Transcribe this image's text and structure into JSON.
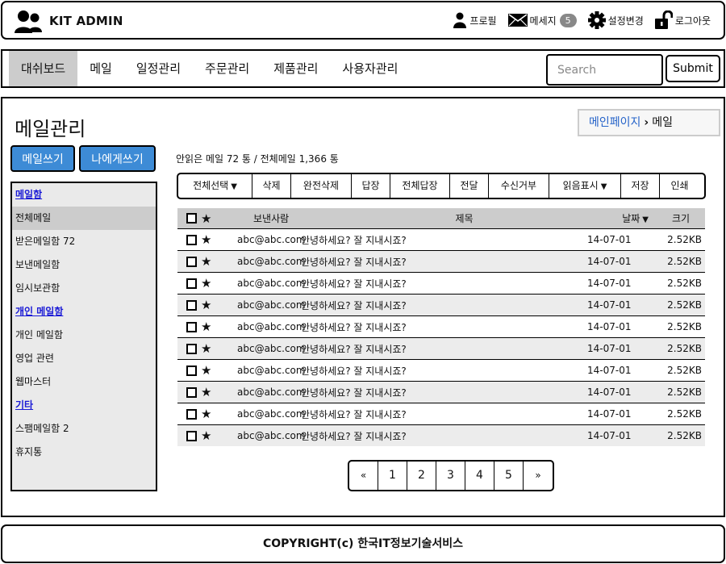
{
  "header": {
    "brand": "KIT ADMIN",
    "profile": "프로필",
    "messages": "메세지",
    "message_count": "5",
    "settings": "설정변경",
    "logout": "로그아웃"
  },
  "nav": {
    "tabs": [
      "대쉬보드",
      "메일",
      "일정관리",
      "주문관리",
      "제품관리",
      "사용자관리"
    ],
    "search_placeholder": "Search",
    "submit": "Submit"
  },
  "page": {
    "title": "메일관리",
    "breadcrumb": [
      "메인페이지",
      "메일"
    ],
    "compose": "메일쓰기",
    "self_compose": "나에게쓰기",
    "summary": "안읽은 메일 72 통 / 전체메일 1,366 통"
  },
  "sidebar": {
    "items": [
      {
        "label": "메일함",
        "type": "head"
      },
      {
        "label": "전체메일",
        "type": "active"
      },
      {
        "label": "받은메일함 72",
        "type": "item"
      },
      {
        "label": "보낸메일함",
        "type": "item"
      },
      {
        "label": "임시보관함",
        "type": "item"
      },
      {
        "label": "개인 메일함",
        "type": "head"
      },
      {
        "label": "개인 메일함",
        "type": "item"
      },
      {
        "label": "영업 관련",
        "type": "item"
      },
      {
        "label": "웹마스터",
        "type": "item"
      },
      {
        "label": "기타",
        "type": "head"
      },
      {
        "label": "스팸메일함 2",
        "type": "item"
      },
      {
        "label": "휴지통",
        "type": "item"
      }
    ]
  },
  "toolbar": {
    "select_all": "전체선택",
    "delete": "삭제",
    "perm_delete": "완전삭제",
    "reply": "답장",
    "reply_all": "전체답장",
    "forward": "전달",
    "block": "수신거부",
    "mark_read": "읽음표시",
    "save": "저장",
    "print": "인쇄"
  },
  "table": {
    "headers": {
      "from": "보낸사람",
      "subject": "제목",
      "date": "날짜",
      "size": "크기"
    },
    "rows": [
      {
        "from": "abc@abc.com",
        "subject": "안녕하세요? 잘 지내시죠?",
        "date": "14-07-01",
        "size": "2.52KB"
      },
      {
        "from": "abc@abc.com",
        "subject": "안녕하세요? 잘 지내시죠?",
        "date": "14-07-01",
        "size": "2.52KB"
      },
      {
        "from": "abc@abc.com",
        "subject": "안녕하세요? 잘 지내시죠?",
        "date": "14-07-01",
        "size": "2.52KB"
      },
      {
        "from": "abc@abc.com",
        "subject": "안녕하세요? 잘 지내시죠?",
        "date": "14-07-01",
        "size": "2.52KB"
      },
      {
        "from": "abc@abc.com",
        "subject": "안녕하세요? 잘 지내시죠?",
        "date": "14-07-01",
        "size": "2.52KB"
      },
      {
        "from": "abc@abc.com",
        "subject": "안녕하세요? 잘 지내시죠?",
        "date": "14-07-01",
        "size": "2.52KB"
      },
      {
        "from": "abc@abc.com",
        "subject": "안녕하세요? 잘 지내시죠?",
        "date": "14-07-01",
        "size": "2.52KB"
      },
      {
        "from": "abc@abc.com",
        "subject": "안녕하세요? 잘 지내시죠?",
        "date": "14-07-01",
        "size": "2.52KB"
      },
      {
        "from": "abc@abc.com",
        "subject": "안녕하세요? 잘 지내시죠?",
        "date": "14-07-01",
        "size": "2.52KB"
      },
      {
        "from": "abc@abc.com",
        "subject": "안녕하세요? 잘 지내시죠?",
        "date": "14-07-01",
        "size": "2.52KB"
      }
    ]
  },
  "pagination": {
    "prev": "«",
    "pages": [
      "1",
      "2",
      "3",
      "4",
      "5"
    ],
    "next": "»"
  },
  "footer": {
    "copyright": "COPYRIGHT(c) 한국IT정보기술서비스"
  }
}
